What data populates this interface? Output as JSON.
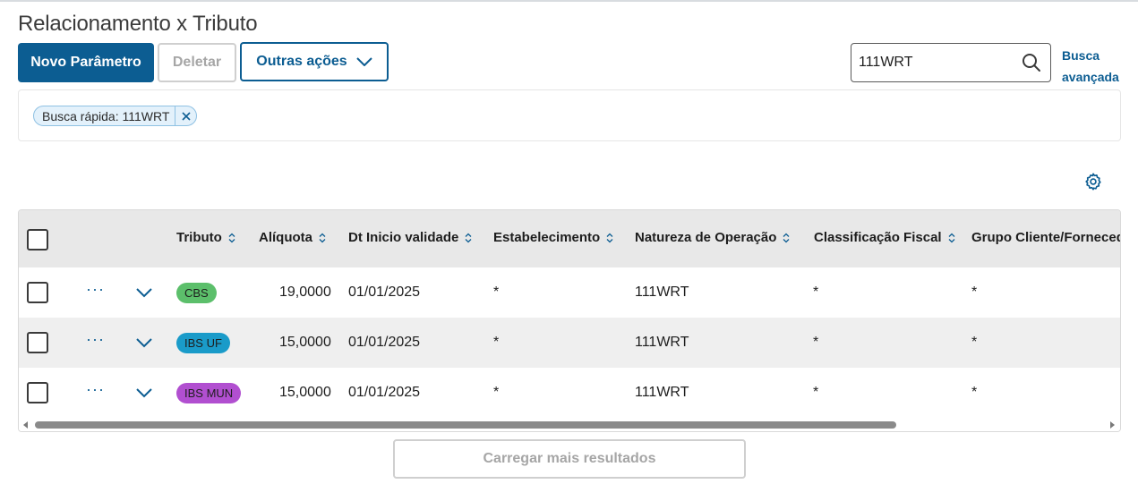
{
  "page": {
    "title": "Relacionamento x Tributo"
  },
  "toolbar": {
    "new_label": "Novo Parâmetro",
    "delete_label": "Deletar",
    "more_label": "Outras ações"
  },
  "search": {
    "value": "111WRT",
    "advanced_label_line1": "Busca",
    "advanced_label_line2": "avançada"
  },
  "filters": {
    "chips": [
      {
        "label": "Busca rápida: 111WRT"
      }
    ]
  },
  "table": {
    "columns": [
      {
        "label": "Tributo"
      },
      {
        "label": "Alíquota"
      },
      {
        "label": "Dt Inicio validade"
      },
      {
        "label": "Estabelecimento"
      },
      {
        "label": "Natureza de Operação"
      },
      {
        "label": "Classificação Fiscal"
      },
      {
        "label": "Grupo Cliente/Fornecedor"
      }
    ],
    "rows": [
      {
        "tributo": "CBS",
        "aliquota": "19,0000",
        "dt_inicio": "01/01/2025",
        "estabelecimento": "*",
        "natureza": "111WRT",
        "classificacao": "*",
        "grupo": "*"
      },
      {
        "tributo": "IBS UF",
        "aliquota": "15,0000",
        "dt_inicio": "01/01/2025",
        "estabelecimento": "*",
        "natureza": "111WRT",
        "classificacao": "*",
        "grupo": "*"
      },
      {
        "tributo": "IBS MUN",
        "aliquota": "15,0000",
        "dt_inicio": "01/01/2025",
        "estabelecimento": "*",
        "natureza": "111WRT",
        "classificacao": "*",
        "grupo": "*"
      }
    ],
    "row_actions_glyph": "···"
  },
  "tag_colors": {
    "CBS": "#5cbf6b",
    "IBS UF": "#1a9bc9",
    "IBS MUN": "#b14fd0"
  },
  "colors": {
    "primary": "#0c5d92",
    "disabled": "#a6a6a6"
  },
  "icons": {
    "search": "search-icon",
    "settings": "gear-icon",
    "expand": "chevron-down-icon",
    "sort": "sort-icon",
    "close": "close-icon"
  },
  "footer": {
    "load_more_label": "Carregar mais resultados"
  }
}
